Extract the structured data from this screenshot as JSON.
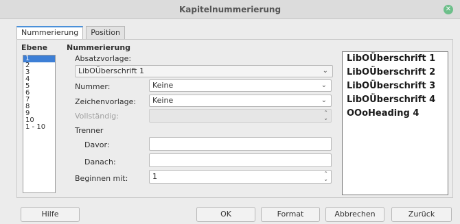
{
  "window": {
    "title": "Kapitelnummerierung"
  },
  "tabs": [
    {
      "label": "Nummerierung"
    },
    {
      "label": "Position"
    }
  ],
  "levels": {
    "header": "Ebene",
    "items": [
      "1",
      "2",
      "3",
      "4",
      "5",
      "6",
      "7",
      "8",
      "9",
      "10",
      "1 - 10"
    ],
    "selected": "1"
  },
  "numbering": {
    "section_title": "Nummerierung",
    "paragraph_style_label": "Absatzvorlage:",
    "paragraph_style_value": "LibOÜberschrift 1",
    "number_label": "Nummer:",
    "number_value": "Keine",
    "char_style_label": "Zeichenvorlage:",
    "char_style_value": "Keine",
    "complete_label": "Vollständig:",
    "complete_value": "",
    "separator_title": "Trenner",
    "before_label": "Davor:",
    "before_value": "",
    "after_label": "Danach:",
    "after_value": "",
    "start_label": "Beginnen mit:",
    "start_value": "1"
  },
  "preview": {
    "lines": [
      "LibOÜberschrift 1",
      "LibOÜberschrift 2",
      "LibOÜberschrift 3",
      "LibOÜberschrift 4",
      "OOoHeading 4"
    ]
  },
  "buttons": {
    "help": "Hilfe",
    "ok": "OK",
    "format": "Format",
    "cancel": "Abbrechen",
    "back": "Zurück"
  }
}
